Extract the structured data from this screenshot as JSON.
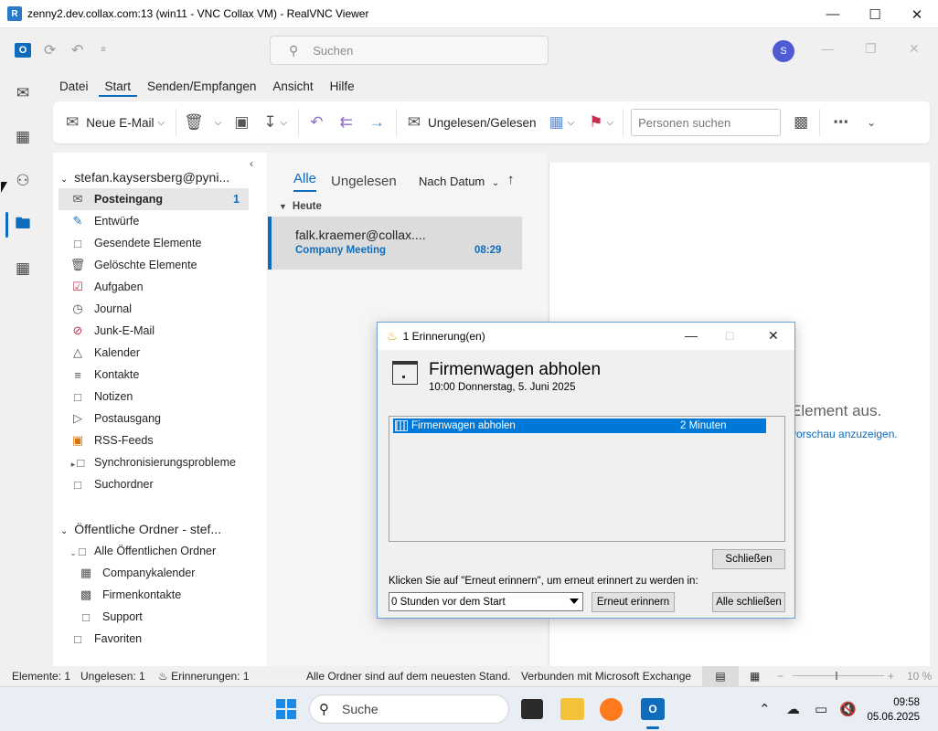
{
  "vnc": {
    "title": "zenny2.dev.collax.com:13 (win11 - VNC Collax VM) - RealVNC Viewer",
    "logo_icon": "realvnc-logo-icon"
  },
  "outlook": {
    "search_placeholder": "Suchen",
    "avatar_initial": "S",
    "menu_tabs": [
      "Datei",
      "Start",
      "Senden/Empfangen",
      "Ansicht",
      "Hilfe"
    ],
    "active_tab": "Start",
    "ribbon": {
      "new_mail": "Neue E-Mail",
      "read_unread": "Ungelesen/Gelesen",
      "people_search_placeholder": "Personen suchen"
    },
    "folder_pane": {
      "account": "stefan.kaysersberg@pyni...",
      "folders": [
        {
          "label": "Posteingang",
          "count": "1",
          "icon": "inbox-icon"
        },
        {
          "label": "Entwürfe",
          "icon": "drafts-icon"
        },
        {
          "label": "Gesendete Elemente",
          "icon": "folder-icon"
        },
        {
          "label": "Gelöschte Elemente",
          "icon": "trash-icon"
        },
        {
          "label": "Aufgaben",
          "icon": "tasks-icon"
        },
        {
          "label": "Journal",
          "icon": "journal-icon"
        },
        {
          "label": "Junk-E-Mail",
          "icon": "junk-icon"
        },
        {
          "label": "Kalender",
          "icon": "calendar-icon"
        },
        {
          "label": "Kontakte",
          "icon": "contacts-icon"
        },
        {
          "label": "Notizen",
          "icon": "notes-icon"
        },
        {
          "label": "Postausgang",
          "icon": "outbox-icon"
        },
        {
          "label": "RSS-Feeds",
          "icon": "rss-icon"
        },
        {
          "label": "Synchronisierungsprobleme",
          "icon": "folder-icon"
        },
        {
          "label": "Suchordner",
          "icon": "search-folder-icon"
        }
      ],
      "public_header": "Öffentliche Ordner - stef...",
      "public_folders": [
        {
          "label": "Alle Öffentlichen Ordner"
        },
        {
          "label": "Companykalender"
        },
        {
          "label": "Firmenkontakte"
        },
        {
          "label": "Support"
        },
        {
          "label": "Favoriten"
        }
      ]
    },
    "message_list": {
      "tab_all": "Alle",
      "tab_unread": "Ungelesen",
      "sort": "Nach Datum",
      "group": "Heute",
      "items": [
        {
          "from": "falk.kraemer@collax....",
          "subject": "Company Meeting",
          "time": "08:29"
        }
      ]
    },
    "reading_pane": {
      "line1": "Element aus.",
      "line2": "vorschau anzuzeigen."
    },
    "status": {
      "elements": "Elemente: 1",
      "unread": "Ungelesen: 1",
      "reminders": "Erinnerungen: 1",
      "sync": "Alle Ordner sind auf dem neuesten Stand.",
      "connection": "Verbunden mit Microsoft Exchange",
      "zoom": "10 %"
    }
  },
  "reminder_dialog": {
    "title": "1 Erinnerung(en)",
    "subject": "Firmenwagen abholen",
    "when": "10:00 Donnerstag, 5. Juni 2025",
    "items": [
      {
        "subject": "Firmenwagen abholen",
        "due": "2 Minuten"
      }
    ],
    "dismiss_label": "Schließen",
    "hint": "Klicken Sie auf \"Erneut erinnern\", um erneut erinnert zu werden in:",
    "snooze_value": "0 Stunden vor dem Start",
    "snooze_label": "Erneut erinnern",
    "dismiss_all_label": "Alle schließen"
  },
  "taskbar": {
    "search_placeholder": "Suche",
    "time": "09:58",
    "date": "05.06.2025"
  },
  "colors": {
    "accent": "#0f6cbd",
    "selection": "#0078d7"
  }
}
